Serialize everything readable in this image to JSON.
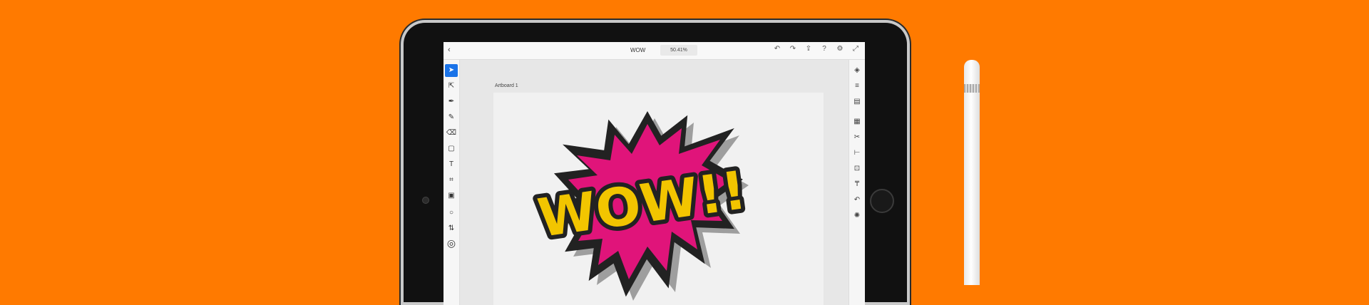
{
  "topbar": {
    "back": "‹",
    "document_title": "WOW",
    "zoom": "50.41%",
    "icons": [
      "undo-icon",
      "redo-icon",
      "share-icon",
      "help-icon",
      "settings-icon",
      "fullscreen-icon"
    ]
  },
  "left_tools": [
    "select",
    "direct-select",
    "pen",
    "pencil",
    "eraser",
    "rectangle",
    "text",
    "crop",
    "image",
    "color",
    "swap",
    "stroke"
  ],
  "right_tools": [
    "layers",
    "properties",
    "libraries",
    "transform",
    "cut",
    "align",
    "combine",
    "type",
    "shape",
    "pathfinder"
  ],
  "artboard": {
    "label": "Artboard 1"
  },
  "art": {
    "text": "WOW!!"
  },
  "colors": {
    "background": "#FF7A00",
    "burst_fill": "#E0147A",
    "burst_outline": "#222222",
    "text_fill": "#F2C500",
    "selected_tool": "#1A73E8"
  }
}
